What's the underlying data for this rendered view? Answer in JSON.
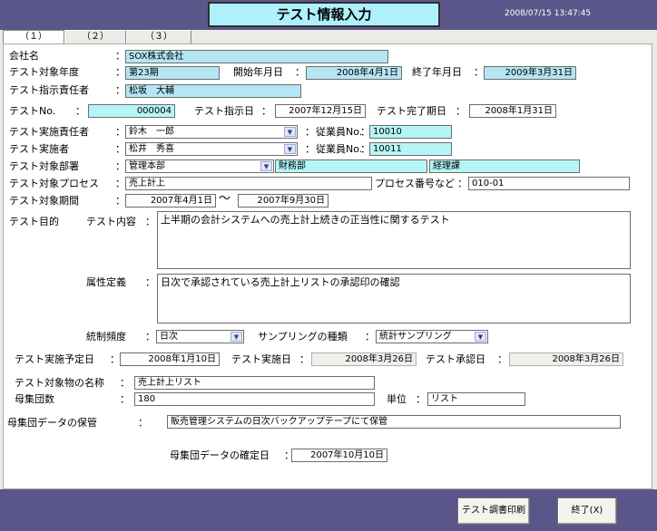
{
  "header": {
    "title": "テスト情報入力",
    "timestamp": "2008/07/15 13:47:45"
  },
  "tabs": [
    "（１）",
    "（２）",
    "（３）"
  ],
  "labels": {
    "company": "会社名",
    "fiscal_year": "テスト対象年度",
    "start_date": "開始年月日",
    "end_date": "終了年月日",
    "instructor": "テスト指示責任者",
    "test_no": "テストNo.",
    "instruction_date": "テスト指示日",
    "completion_due": "テスト完了期日",
    "executor_lead": "テスト実施責任者",
    "employee_no": "従業員No.",
    "executor": "テスト実施者",
    "department": "テスト対象部署",
    "process": "テスト対象プロセス",
    "process_no": "プロセス番号など",
    "period": "テスト対象期間",
    "period_sep": "〜",
    "purpose": "テスト目的",
    "content": "テスト内容",
    "attribute": "属性定義",
    "frequency": "統制頻度",
    "sampling": "サンプリングの種類",
    "planned_date": "テスト実施予定日",
    "execution_date": "テスト実施日",
    "approval_date": "テスト承認日",
    "object_name": "テスト対象物の名称",
    "population": "母集団数",
    "unit": "単位",
    "data_storage": "母集団データの保管",
    "confirm_date": "母集団データの確定日",
    "colon": "："
  },
  "values": {
    "company": "SOX株式会社",
    "fiscal_year": "第23期",
    "start_date": "2008年4月1日",
    "end_date": "2009年3月31日",
    "instructor": "松坂　大輔",
    "test_no": "000004",
    "instruction_date": "2007年12月15日",
    "completion_due": "2008年1月31日",
    "executor_lead": "鈴木　一郎",
    "executor_lead_no": "10010",
    "executor": "松井　秀喜",
    "executor_no": "10011",
    "department_1": "管理本部",
    "department_2": "財務部",
    "department_3": "経理課",
    "process": "売上計上",
    "process_no": "010-01",
    "period_from": "2007年4月1日",
    "period_to": "2007年9月30日",
    "content": "上半期の会計システムへの売上計上続きの正当性に関するテスト",
    "attribute": "日次で承認されている売上計上リストの承認印の確認",
    "frequency": "日次",
    "sampling": "統計サンプリング",
    "planned_date": "2008年1月10日",
    "execution_date": "2008年3月26日",
    "approval_date": "2008年3月26日",
    "object_name": "売上計上リスト",
    "population": "180",
    "unit": "リスト",
    "data_storage": "販売管理システムの日次バックアップテープにて保管",
    "confirm_date": "2007年10月10日"
  },
  "buttons": {
    "print": "テスト調書印刷",
    "exit": "終了(X)"
  },
  "icons": {
    "dropdown": "chevron-down-icon"
  }
}
